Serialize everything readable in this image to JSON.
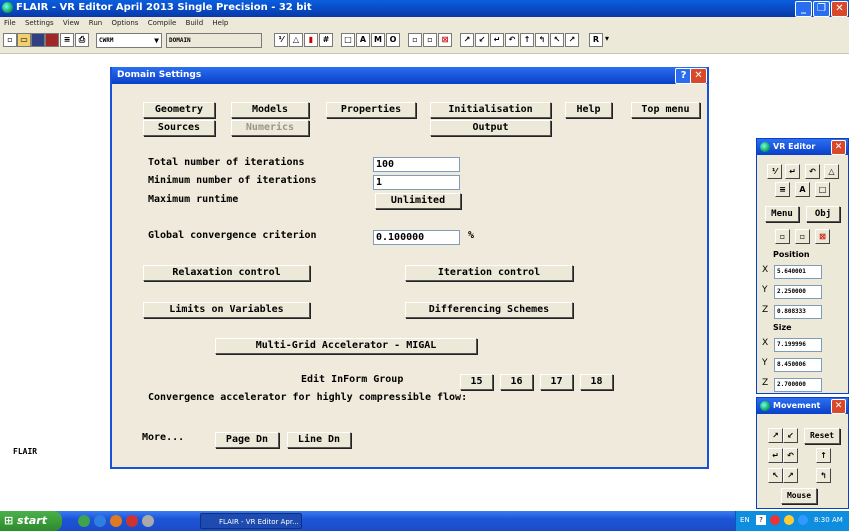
{
  "window": {
    "title": "FLAIR - VR Editor April 2013 Single Precision - 32 bit",
    "min": "_",
    "max": "❐",
    "close": "✕"
  },
  "menubar": [
    "File",
    "Settings",
    "View",
    "Run",
    "Options",
    "Compile",
    "Build",
    "Help"
  ],
  "toolbar": {
    "select1": "CWRM",
    "select2": "DOMAIN",
    "r_button": "R"
  },
  "side_label": "FLAIR",
  "dialog": {
    "title": "Domain Settings",
    "help": "?",
    "close": "✕",
    "tabs_row1": [
      "Geometry",
      "Models",
      "Properties",
      "Initialisation",
      "Help",
      "Top menu"
    ],
    "tabs_row2": [
      "Sources",
      "Numerics",
      "Output"
    ],
    "total_iter_label": "Total number of iterations",
    "total_iter_value": "100",
    "min_iter_label": "Minimum number of iterations",
    "min_iter_value": "1",
    "max_runtime_label": "Maximum runtime",
    "max_runtime_button": "Unlimited",
    "conv_label": "Global convergence criterion",
    "conv_value": "0.100000",
    "conv_unit": "%",
    "relax_btn": "Relaxation control",
    "iter_ctrl_btn": "Iteration control",
    "limits_btn": "Limits on Variables",
    "diff_btn": "Differencing Schemes",
    "migal_btn": "Multi-Grid Accelerator - MIGAL",
    "inform_label": "Edit InForm Group",
    "groups": [
      "15",
      "16",
      "17",
      "18"
    ],
    "compressible_label": "Convergence accelerator for highly compressible flow:",
    "more_label": "More...",
    "page_dn": "Page Dn",
    "line_dn": "Line Dn"
  },
  "vr_editor": {
    "title": "VR Editor",
    "close": "✕",
    "menu_btn": "Menu",
    "obj_btn": "Obj",
    "position_label": "Position",
    "pos": [
      {
        "axis": "X",
        "value": "5.640001"
      },
      {
        "axis": "Y",
        "value": "2.250000"
      },
      {
        "axis": "Z",
        "value": "0.808333"
      }
    ],
    "size_label": "Size",
    "size": [
      {
        "axis": "X",
        "value": "7.199996"
      },
      {
        "axis": "Y",
        "value": "8.450006"
      },
      {
        "axis": "Z",
        "value": "2.700000"
      }
    ]
  },
  "movement": {
    "title": "Movement",
    "close": "✕",
    "reset_btn": "Reset",
    "mouse_btn": "Mouse"
  },
  "taskbar": {
    "start": "start",
    "app": "FLAIR - VR Editor Apr...",
    "lang": "EN",
    "time": "8:30 AM"
  }
}
